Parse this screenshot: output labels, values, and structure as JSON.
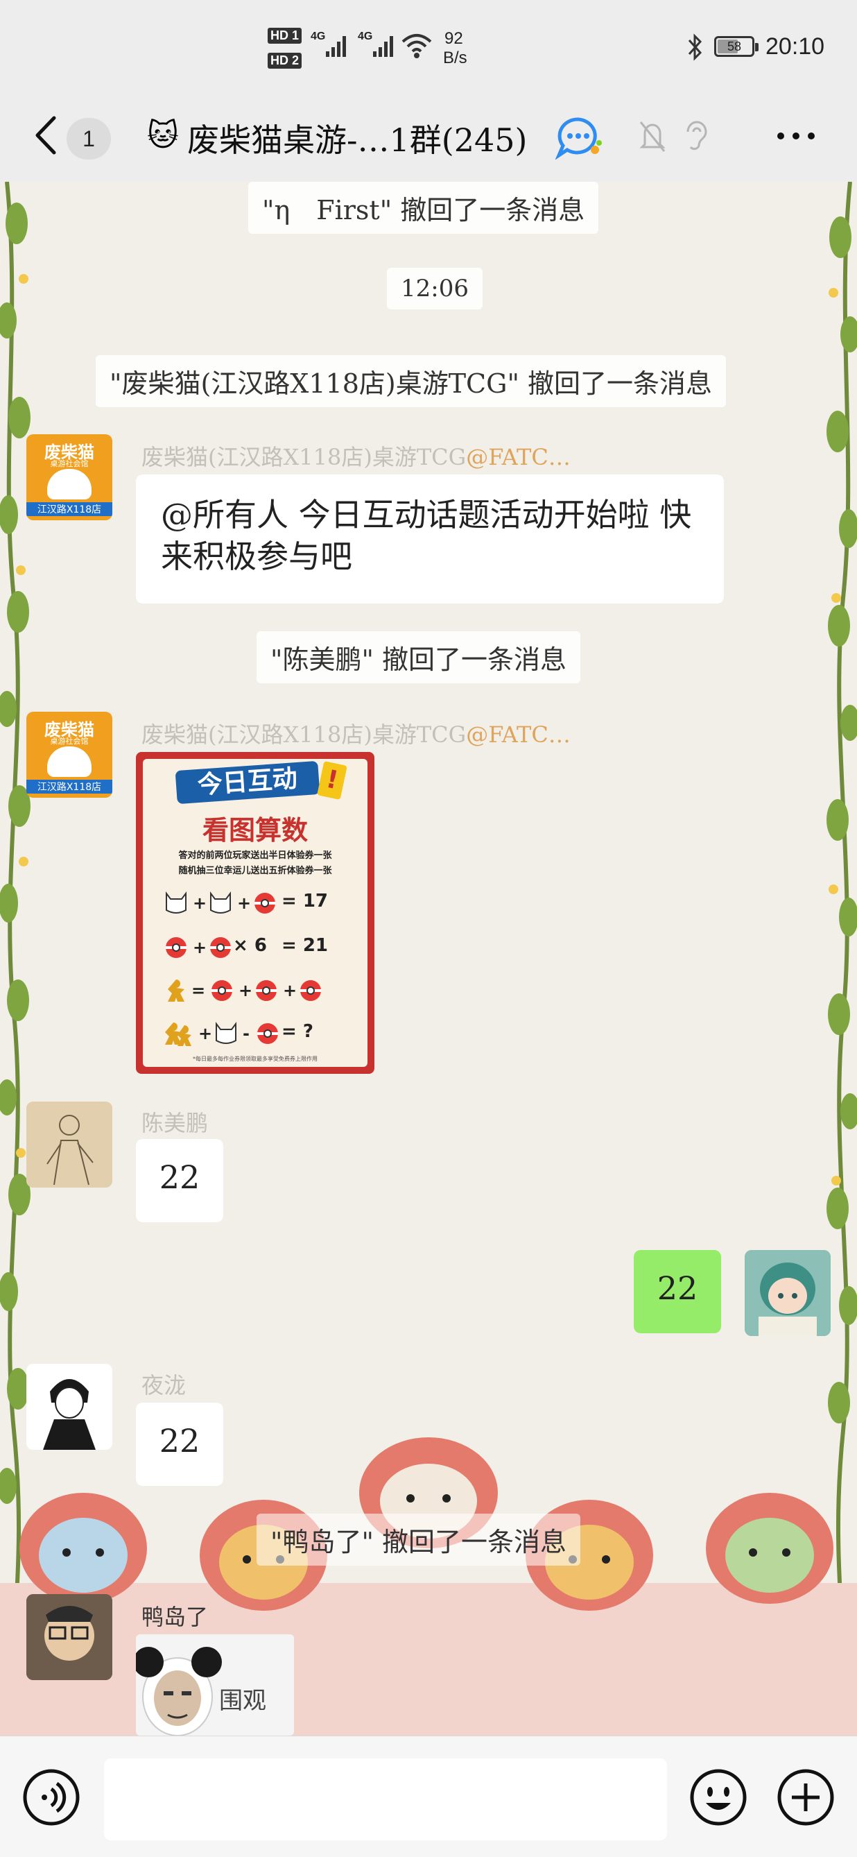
{
  "status_bar": {
    "hd1": "HD 1",
    "hd2": "HD 2",
    "net1": "4G",
    "net2": "4G",
    "speed_value": "92",
    "speed_unit": "B/s",
    "battery": "58",
    "time": "20:10"
  },
  "nav": {
    "unread_count": "1",
    "title_emoji": "🐱",
    "title": "废柴猫桌游-…1群(245)"
  },
  "messages": {
    "recall_1": "\"η　First\" 撤回了一条消息",
    "timestamp": "12:06",
    "recall_2": "\"废柴猫(江汉路X118店)桌游TCG\" 撤回了一条消息",
    "msg1_sender": "废柴猫(江汉路X118店)桌游TCG",
    "msg1_sender_tag": "@FATC…",
    "msg1_text": "@所有人  今日互动话题活动开始啦 快来积极参与吧",
    "recall_3": "\"陈美鹏\" 撤回了一条消息",
    "msg2_sender": "废柴猫(江汉路X118店)桌游TCG",
    "msg2_sender_tag": "@FATC…",
    "msg3_sender": "陈美鹏",
    "msg3_text": "22",
    "msg4_text": "22",
    "msg5_sender": "夜泷",
    "msg5_text": "22",
    "recall_4": "\"鸭岛了\" 撤回了一条消息",
    "msg6_sender": "鸭岛了",
    "msg6_sticker_text": "围观"
  },
  "avatar_text": {
    "shop_top": "废柴猫",
    "shop_sub": "桌游社会馆",
    "shop_bottom": "江汉路X118店"
  },
  "poster": {
    "badge": "今日互动",
    "badge_mark": "!",
    "title": "看图算数",
    "line1": "答对的前两位玩家送出半日体验券一张",
    "line2": "随机抽三位幸运儿送出五折体验券一张",
    "eq1_result": "= 17",
    "eq2_op": "× 6",
    "eq2_result": "= 21",
    "eq4_result": "= ?",
    "footer": "*每日最多每作业券限领取最多享受免费券上限作用"
  },
  "colors": {
    "accent_green": "#95ec69",
    "poster_red": "#c8322e",
    "sender_gray": "#c4c0b8",
    "sender_tag": "#e0a35a"
  },
  "icons": {
    "back": "chevron-left-icon",
    "group_ai": "chat-bubble-icon",
    "mute": "bell-off-icon",
    "ear": "ear-icon",
    "more": "more-icon",
    "voice": "voice-icon",
    "emoji": "emoji-icon",
    "add": "plus-icon"
  }
}
